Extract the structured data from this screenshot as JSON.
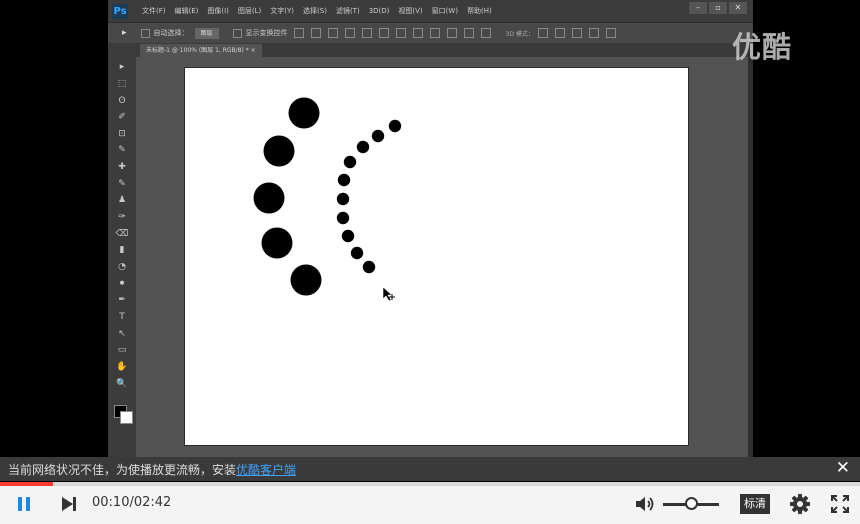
{
  "app": {
    "logo": "Ps",
    "menus": [
      "文件(F)",
      "编辑(E)",
      "图像(I)",
      "图层(L)",
      "文字(Y)",
      "选择(S)",
      "滤镜(T)",
      "3D(D)",
      "视图(V)",
      "窗口(W)",
      "帮助(H)"
    ],
    "window_buttons": [
      "–",
      "▫",
      "✕"
    ]
  },
  "options_bar": {
    "tool_glyph": "▸",
    "auto_select_label": "自动选择：",
    "auto_select_value": "图层",
    "show_transform_label": "显示变换控件",
    "mode_3d_label": "3D 模式："
  },
  "document": {
    "tab_title": "未标题-1 @ 100% (图层 1, RGB/8) * ×",
    "canvas_bg": "#ffffff",
    "dot_color": "#000000"
  },
  "tools": [
    "▸",
    "⬚",
    "ʘ",
    "✐",
    "⊡",
    "✎",
    "✚",
    "✎",
    "♟",
    "✑",
    "⌫",
    "▮",
    "◔",
    "⚫",
    "✒",
    "T",
    "↖",
    "▭",
    "✋",
    "🔍"
  ],
  "watermark": "优酷",
  "notice": {
    "text": "当前网络状况不佳，为使播放更流畅，安装",
    "link": "优酷客户端",
    "close": "✕"
  },
  "player": {
    "current_time": "00:10",
    "total_time": "/02:42",
    "progress_fraction": 0.062,
    "volume_fraction": 0.5,
    "quality": "标清",
    "accent": "#ff3b30",
    "link_color": "#3fa3ff"
  }
}
